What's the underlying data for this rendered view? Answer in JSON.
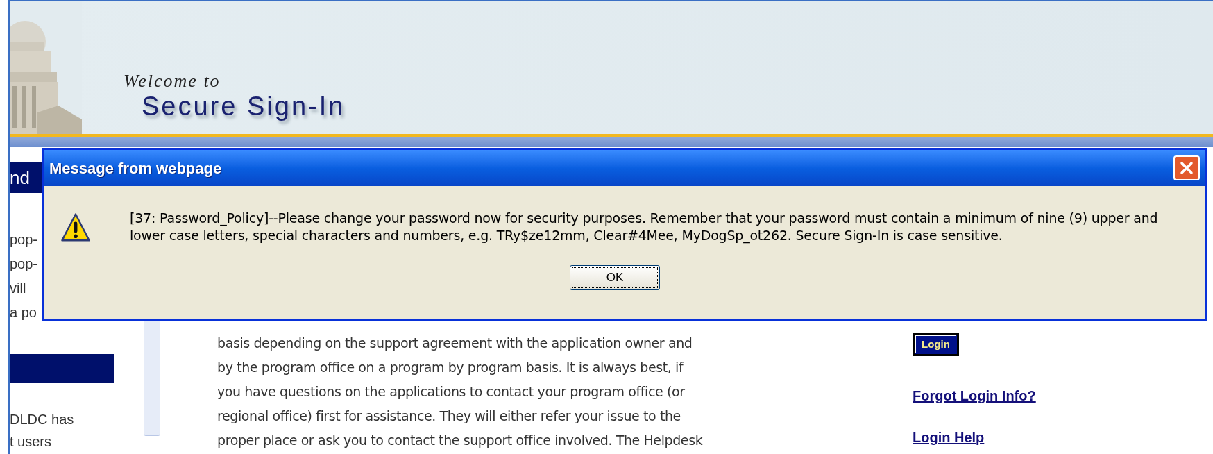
{
  "header": {
    "welcome": "Welcome to",
    "title": "Secure Sign-In"
  },
  "sidebar": {
    "heading": "nd",
    "lines": [
      "pop-",
      "pop-",
      "vill",
      "a po"
    ],
    "lower_lines": [
      "DLDC has",
      "t users"
    ]
  },
  "main": {
    "lines": [
      "basis depending on the support agreement with the application owner and",
      "by the program office on a program by program basis. It is always best, if",
      "you have questions on the applications to contact your program office (or",
      "regional office) first for assistance. They will either refer your issue to the",
      "proper place or ask you to contact the support office involved. The Helpdesk"
    ]
  },
  "login": {
    "button": "Login",
    "links": [
      "Forgot Login Info?",
      "Login Help"
    ]
  },
  "dialog": {
    "title": "Message from webpage",
    "message": "[37: Password_Policy]--Please change your password now for security purposes. Remember that your password must contain a minimum of nine (9) upper and lower case letters, special characters and numbers, e.g. TRy$ze12mm, Clear#4Mee, MyDogSp_ot262. Secure Sign-In is case sensitive.",
    "button": "OK"
  }
}
